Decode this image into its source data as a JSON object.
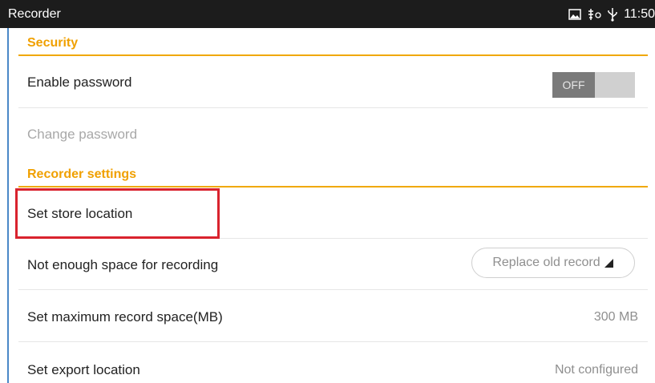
{
  "status_bar": {
    "app_title": "Recorder",
    "time": "11:50",
    "icons": [
      "gallery-icon",
      "usb-debug-icon",
      "usb-icon"
    ]
  },
  "security": {
    "header": "Security",
    "enable_password_label": "Enable password",
    "toggle_state": "OFF",
    "change_password_label": "Change password"
  },
  "recorder_settings": {
    "header": "Recorder settings",
    "store_location_label": "Set store location",
    "not_enough_space_label": "Not enough space for recording",
    "not_enough_space_value": "Replace old record",
    "max_space_label": "Set maximum record space(MB)",
    "max_space_value": "300 MB",
    "export_location_label": "Set export location",
    "export_location_value": "Not configured"
  },
  "colors": {
    "accent": "#f0a000",
    "highlight_box": "#d9232e",
    "status_bar_bg": "#1c1c1c",
    "left_rule": "#4a88c7"
  }
}
